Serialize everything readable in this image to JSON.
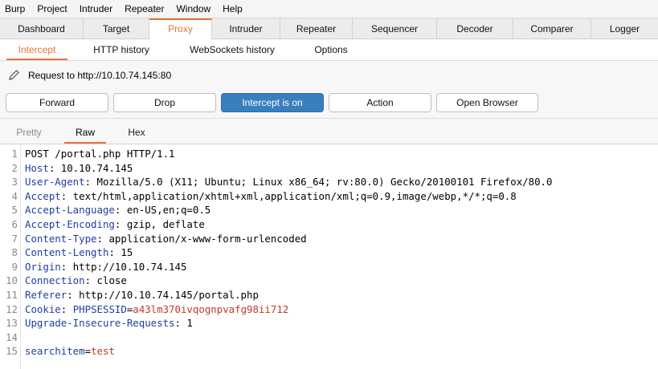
{
  "menubar": [
    "Burp",
    "Project",
    "Intruder",
    "Repeater",
    "Window",
    "Help"
  ],
  "main_tabs": [
    "Dashboard",
    "Target",
    "Proxy",
    "Intruder",
    "Repeater",
    "Sequencer",
    "Decoder",
    "Comparer",
    "Logger"
  ],
  "active_main_tab": "Proxy",
  "proxy_tabs": [
    "Intercept",
    "HTTP history",
    "WebSockets history",
    "Options"
  ],
  "active_proxy_tab": "Intercept",
  "request_label": "Request to http://10.10.74.145:80",
  "buttons": {
    "forward": "Forward",
    "drop": "Drop",
    "intercept": "Intercept is on",
    "action": "Action",
    "open_browser": "Open Browser"
  },
  "view_tabs": [
    "Pretty",
    "Raw",
    "Hex"
  ],
  "active_view_tab": "Raw",
  "colors": {
    "accent": "#e8733a",
    "intercept_on": "#3a7fbd",
    "header_name": "#1f3da3",
    "cookie_value": "#c0392b"
  },
  "request": {
    "request_line": "POST /portal.php HTTP/1.1",
    "headers": [
      {
        "name": "Host",
        "value": "10.10.74.145"
      },
      {
        "name": "User-Agent",
        "value": "Mozilla/5.0 (X11; Ubuntu; Linux x86_64; rv:80.0) Gecko/20100101 Firefox/80.0"
      },
      {
        "name": "Accept",
        "value": "text/html,application/xhtml+xml,application/xml;q=0.9,image/webp,*/*;q=0.8"
      },
      {
        "name": "Accept-Language",
        "value": "en-US,en;q=0.5"
      },
      {
        "name": "Accept-Encoding",
        "value": "gzip, deflate"
      },
      {
        "name": "Content-Type",
        "value": "application/x-www-form-urlencoded"
      },
      {
        "name": "Content-Length",
        "value": "15"
      },
      {
        "name": "Origin",
        "value": "http://10.10.74.145"
      },
      {
        "name": "Connection",
        "value": "close"
      },
      {
        "name": "Referer",
        "value": "http://10.10.74.145/portal.php"
      }
    ],
    "cookie": {
      "header": "Cookie",
      "name": "PHPSESSID",
      "value": "a43lm370ivqognpvafg98ii712"
    },
    "last_header": {
      "name": "Upgrade-Insecure-Requests",
      "value": "1"
    },
    "body": {
      "key": "searchitem",
      "value": "test"
    }
  }
}
